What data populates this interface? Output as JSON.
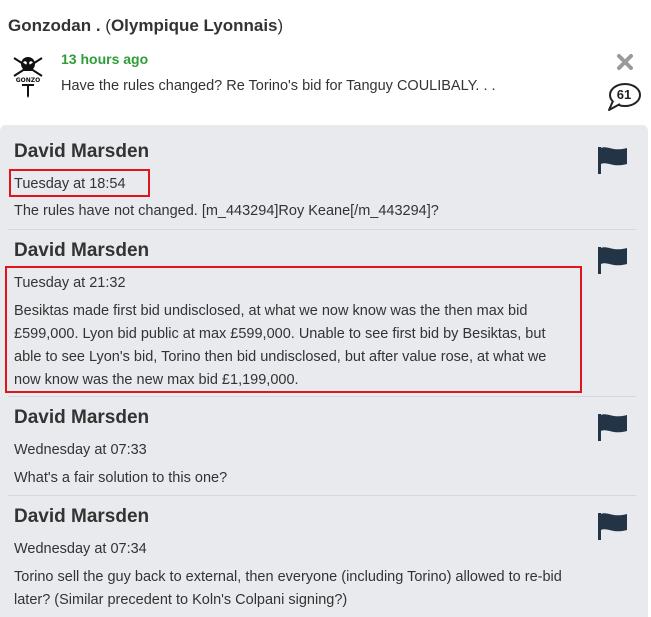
{
  "topic": {
    "username": "Gonzodan .",
    "club_open": "(",
    "club": "Olympique Lyonnais",
    "club_close": ")",
    "avatar_icon": "skull-dagger-icon",
    "avatar_text": "GONZO",
    "time_ago": "13 hours ago",
    "title": "Have the rules changed? Re Torino's bid for Tanguy COULIBALY. . .",
    "reply_count": "61",
    "close_icon": "close-icon",
    "comment_icon": "speech-bubble-icon"
  },
  "colors": {
    "time_green": "#2e9d3a",
    "thread_bg": "#e8eaed",
    "highlight_red": "#e0151b",
    "flag_fill": "#243447"
  },
  "posts": [
    {
      "author": "David Marsden",
      "time": "Tuesday at 18:54",
      "body": "The rules have not changed. [m_443294]Roy Keane[/m_443294]?",
      "flag_icon": "flag-icon"
    },
    {
      "author": "David Marsden",
      "time": "Tuesday at 21:32",
      "body": "Besiktas made first bid undisclosed, at what we now know was the then max bid £599,000. Lyon bid public at max £599,000. Unable to see first bid by Besiktas, but able to see Lyon's bid, Torino then bid undisclosed, but after value rose, at what we now know was the new max bid £1,199,000.",
      "flag_icon": "flag-icon"
    },
    {
      "author": "David Marsden",
      "time": "Wednesday at 07:33",
      "body": "What's a fair solution to this one?",
      "flag_icon": "flag-icon"
    },
    {
      "author": "David Marsden",
      "time": "Wednesday at 07:34",
      "body": "Torino sell the guy back to external, then everyone (including Torino) allowed to re-bid later? (Similar precedent to Koln's Colpani signing?)",
      "flag_icon": "flag-icon"
    }
  ]
}
